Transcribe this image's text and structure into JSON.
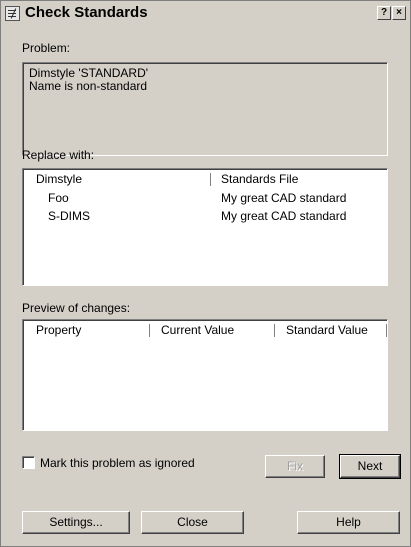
{
  "window": {
    "title": "Check Standards",
    "help_button": "?",
    "close_button": "×"
  },
  "problem": {
    "label": "Problem:",
    "lines": [
      "Dimstyle 'STANDARD'",
      "Name is non-standard"
    ]
  },
  "replace": {
    "label": "Replace with:",
    "columns": [
      "Dimstyle",
      "Standards File"
    ],
    "rows": [
      [
        "Foo",
        "My great CAD standard"
      ],
      [
        "S-DIMS",
        "My great CAD standard"
      ]
    ]
  },
  "preview": {
    "label": "Preview of changes:",
    "columns": [
      "Property",
      "Current Value",
      "Standard Value"
    ]
  },
  "ignore_checkbox": {
    "label": "Mark this problem as ignored",
    "checked": false
  },
  "buttons": {
    "fix": "Fix",
    "next": "Next",
    "settings": "Settings...",
    "close": "Close",
    "help": "Help"
  }
}
